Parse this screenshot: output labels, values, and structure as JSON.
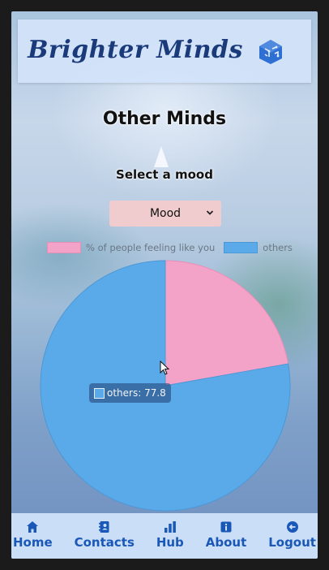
{
  "header": {
    "brand": "Brighter Minds",
    "logo_icon": "brain-cube-icon"
  },
  "page": {
    "title": "Other Minds",
    "select_label": "Select a mood"
  },
  "mood_select": {
    "value": "Mood"
  },
  "legend": {
    "items": [
      {
        "label": "% of people feeling like you",
        "color": "#f4a3c8"
      },
      {
        "label": "others",
        "color": "#5aaae9"
      }
    ]
  },
  "chart_data": {
    "type": "pie",
    "labels": [
      "% of people feeling like you",
      "others"
    ],
    "values": [
      22.2,
      77.8
    ],
    "colors": [
      "#f4a3c8",
      "#5aaae9"
    ]
  },
  "tooltip": {
    "text": "others: 77.8"
  },
  "nav": {
    "items": [
      {
        "label": "Home",
        "icon": "home-icon"
      },
      {
        "label": "Contacts",
        "icon": "contacts-icon"
      },
      {
        "label": "Hub",
        "icon": "hub-icon"
      },
      {
        "label": "About",
        "icon": "info-icon"
      },
      {
        "label": "Logout",
        "icon": "logout-icon"
      }
    ]
  }
}
